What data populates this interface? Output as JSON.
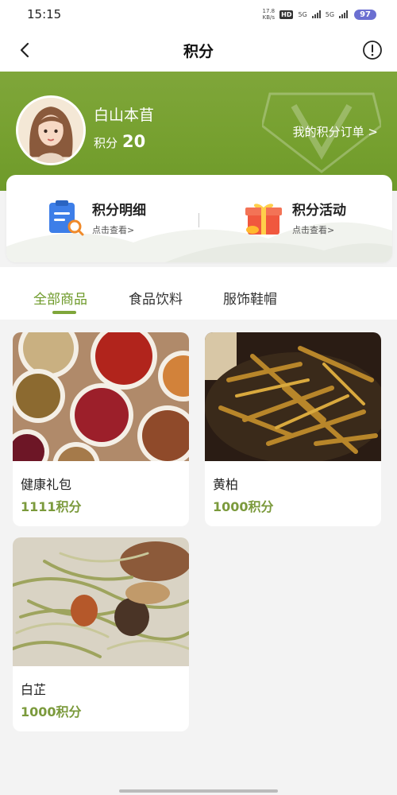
{
  "status_bar": {
    "time": "15:15",
    "speed_value": "17.8",
    "speed_unit": "KB/s",
    "hd_badge": "HD",
    "network_1": "5G",
    "network_2": "5G",
    "battery": "97"
  },
  "nav": {
    "title": "积分",
    "back_icon": "back-chevron-icon",
    "info_icon": "info-circle-icon"
  },
  "profile": {
    "name": "白山本苜",
    "points_label": "积分",
    "points_value": "20",
    "orders_link": "我的积分订单 >"
  },
  "actions": [
    {
      "title": "积分明细",
      "subtitle": "点击查看>",
      "icon": "clipboard-search-icon"
    },
    {
      "title": "积分活动",
      "subtitle": "点击查看>",
      "icon": "gift-box-icon"
    }
  ],
  "tabs": [
    {
      "label": "全部商品",
      "active": true
    },
    {
      "label": "食品饮料",
      "active": false
    },
    {
      "label": "服饰鞋帽",
      "active": false
    }
  ],
  "products": [
    {
      "name": "健康礼包",
      "price": "1111积分"
    },
    {
      "name": "黄柏",
      "price": "1000积分"
    },
    {
      "name": "白芷",
      "price": "1000积分"
    }
  ],
  "colors": {
    "accent_green": "#7fa63a",
    "price_green": "#7b9a3c",
    "battery": "#6b6fd1"
  }
}
